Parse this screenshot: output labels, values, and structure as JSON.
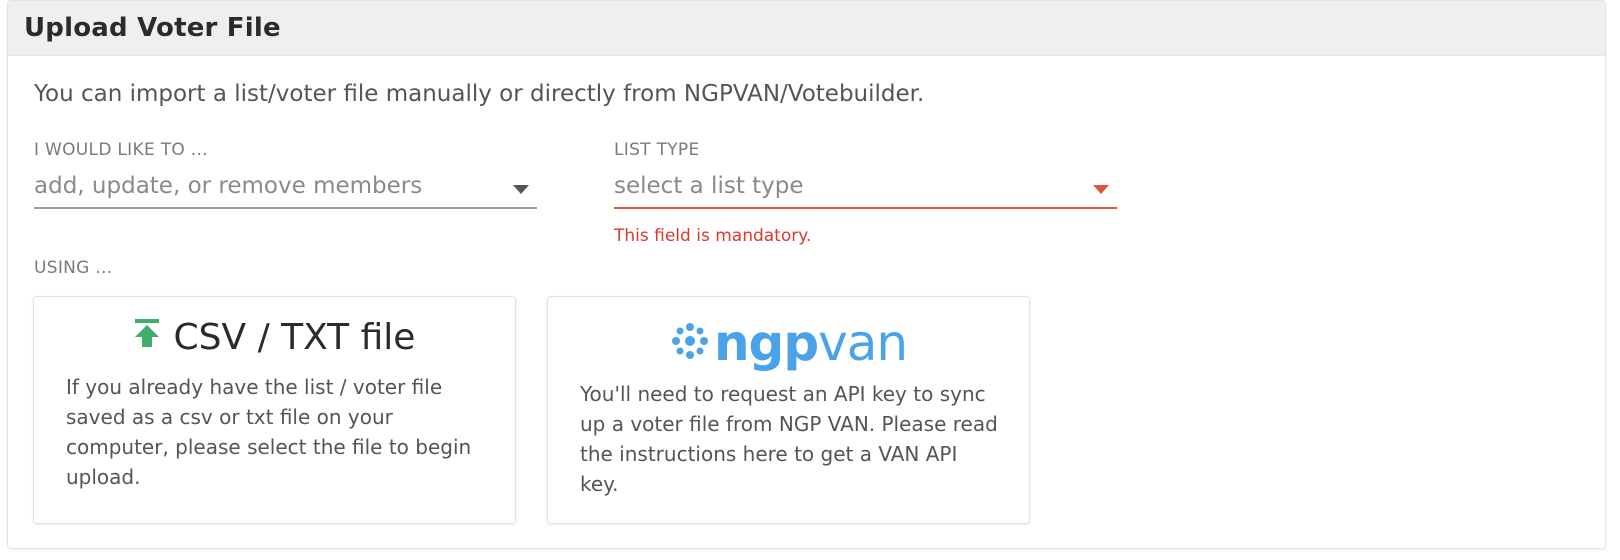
{
  "header": {
    "title": "Upload Voter File"
  },
  "intro": "You can import a list/voter file manually or directly from NGPVAN/Votebuilder.",
  "action_field": {
    "label": "I WOULD LIKE TO ...",
    "placeholder": "add, update, or remove members"
  },
  "list_type_field": {
    "label": "LIST TYPE",
    "placeholder": "select a list type",
    "error": "This field is mandatory."
  },
  "using_label": "USING ...",
  "csv_card": {
    "title": "CSV / TXT file",
    "description": "If you already have the list / voter file saved as a csv or txt file on your computer, please select the file to begin upload."
  },
  "ngpvan_card": {
    "logo_text_bold": "ngp",
    "logo_text_light": "van",
    "description": "You'll need to request an API key to sync up a voter file from NGP VAN. Please read the instructions here to get a VAN API key."
  },
  "colors": {
    "error": "#d83a2e",
    "upload_icon": "#3fae6b",
    "ngpvan_logo": "#4aa3e8"
  },
  "icons": {
    "upload": "upload-arrow-icon",
    "dropdown": "chevron-down-icon",
    "ngpvan_dots": "ngpvan-dots-logo"
  }
}
